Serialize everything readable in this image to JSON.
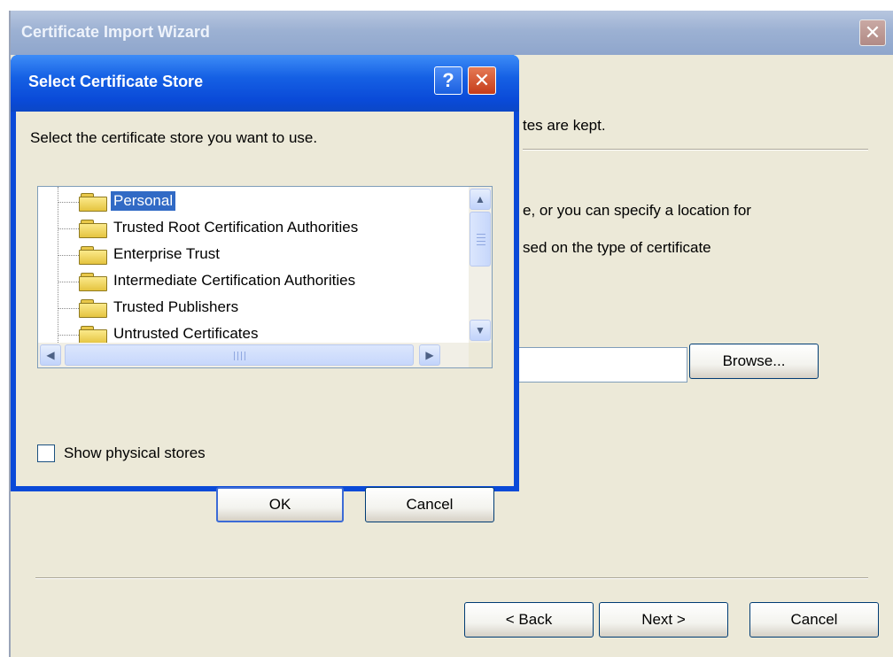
{
  "wizard": {
    "title": "Certificate Import Wizard",
    "close_glyph": "✕",
    "line1": "tes are kept.",
    "line2": "e, or you can specify a location for",
    "line3": "sed on the type of certificate",
    "browse_label": "Browse...",
    "back_label": "< Back",
    "next_label": "Next >",
    "cancel_label": "Cancel"
  },
  "dialog": {
    "title": "Select Certificate Store",
    "help_glyph": "?",
    "close_glyph": "✕",
    "instruction": "Select the certificate store you want to use.",
    "stores": [
      {
        "label": "Personal",
        "selected": true
      },
      {
        "label": "Trusted Root Certification Authorities",
        "selected": false
      },
      {
        "label": "Enterprise Trust",
        "selected": false
      },
      {
        "label": "Intermediate Certification Authorities",
        "selected": false
      },
      {
        "label": "Trusted Publishers",
        "selected": false
      },
      {
        "label": "Untrusted Certificates",
        "selected": false
      }
    ],
    "show_physical_label": "Show physical stores",
    "show_physical_checked": false,
    "ok_label": "OK",
    "cancel_label": "Cancel"
  },
  "colors": {
    "dialog_frame": "#0a4ad8",
    "selection": "#316ac5",
    "face": "#ece9d8"
  }
}
